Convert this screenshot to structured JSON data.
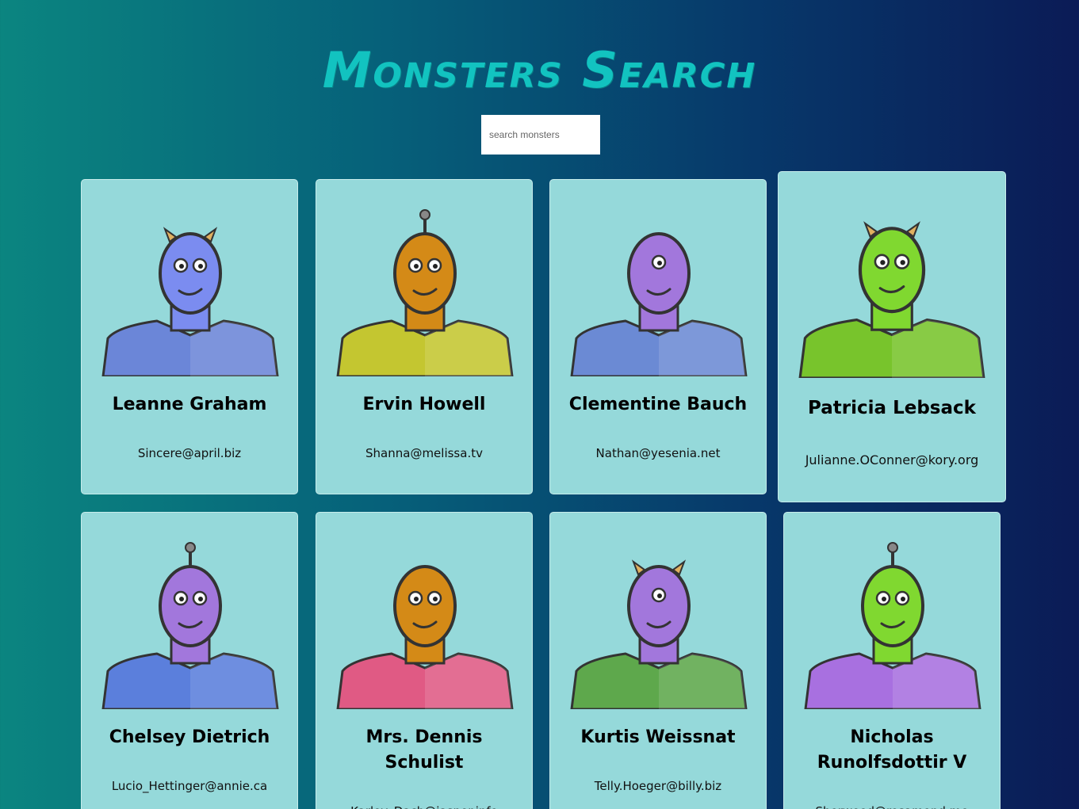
{
  "header": {
    "title": "Monsters Search"
  },
  "search": {
    "placeholder": "search monsters",
    "value": ""
  },
  "monsters": [
    {
      "name": "Leanne Graham",
      "email": "Sincere@april.biz",
      "skin": "#7b8cf0",
      "shirt": "#6b86d8",
      "eyes": 2
    },
    {
      "name": "Ervin Howell",
      "email": "Shanna@melissa.tv",
      "skin": "#d48a17",
      "shirt": "#c4c630",
      "eyes": 2
    },
    {
      "name": "Clementine Bauch",
      "email": "Nathan@yesenia.net",
      "skin": "#a277dc",
      "shirt": "#6b8ad4",
      "eyes": 1
    },
    {
      "name": "Patricia Lebsack",
      "email": "Julianne.OConner@kory.org",
      "skin": "#80d830",
      "shirt": "#78c42c",
      "eyes": 2
    },
    {
      "name": "Chelsey Dietrich",
      "email": "Lucio_Hettinger@annie.ca",
      "skin": "#a277dc",
      "shirt": "#5b7fdc",
      "eyes": 2
    },
    {
      "name": "Mrs. Dennis Schulist",
      "email": "Karley_Dach@jasper.info",
      "skin": "#d48a17",
      "shirt": "#e05a84",
      "eyes": 2
    },
    {
      "name": "Kurtis Weissnat",
      "email": "Telly.Hoeger@billy.biz",
      "skin": "#a277dc",
      "shirt": "#5ea84c",
      "eyes": 1
    },
    {
      "name": "Nicholas Runolfsdottir V",
      "email": "Sherwood@rosamond.me",
      "skin": "#80d830",
      "shirt": "#a870e0",
      "eyes": 2
    }
  ]
}
